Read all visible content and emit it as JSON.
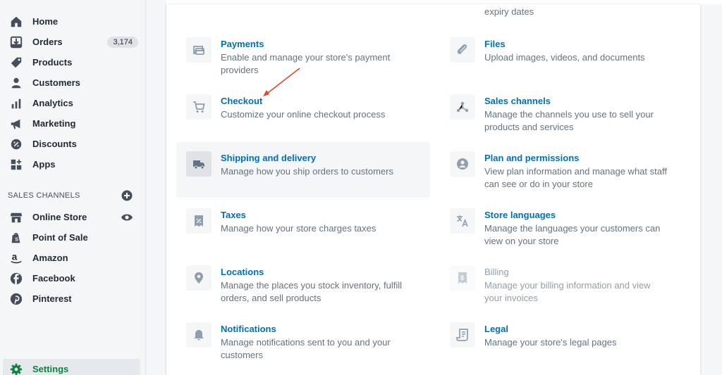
{
  "sidebar": {
    "items": [
      {
        "label": "Home"
      },
      {
        "label": "Orders",
        "badge": "3,174"
      },
      {
        "label": "Products"
      },
      {
        "label": "Customers"
      },
      {
        "label": "Analytics"
      },
      {
        "label": "Marketing"
      },
      {
        "label": "Discounts"
      },
      {
        "label": "Apps"
      }
    ],
    "sales_channels_heading": "SALES CHANNELS",
    "channels": [
      {
        "label": "Online Store"
      },
      {
        "label": "Point of Sale"
      },
      {
        "label": "Amazon"
      },
      {
        "label": "Facebook"
      },
      {
        "label": "Pinterest"
      }
    ],
    "settings_label": "Settings"
  },
  "settings": {
    "top_right_desc": "expiry dates",
    "left": [
      {
        "title": "Payments",
        "desc": "Enable and manage your store's payment providers",
        "icon": "payments-icon"
      },
      {
        "title": "Checkout",
        "desc": "Customize your online checkout process",
        "icon": "cart-icon"
      },
      {
        "title": "Shipping and delivery",
        "desc": "Manage how you ship orders to customers",
        "icon": "truck-icon"
      },
      {
        "title": "Taxes",
        "desc": "Manage how your store charges taxes",
        "icon": "taxes-icon"
      },
      {
        "title": "Locations",
        "desc": "Manage the places you stock inventory, fulfill orders, and sell products",
        "icon": "location-icon"
      },
      {
        "title": "Notifications",
        "desc": "Manage notifications sent to you and your customers",
        "icon": "bell-icon"
      }
    ],
    "right": [
      {
        "title": "Files",
        "desc": "Upload images, videos, and documents",
        "icon": "paperclip-icon"
      },
      {
        "title": "Sales channels",
        "desc": "Manage the channels you use to sell your products and services",
        "icon": "channels-icon"
      },
      {
        "title": "Plan and permissions",
        "desc": "View plan information and manage what staff can see or do in your store",
        "icon": "user-circle-icon"
      },
      {
        "title": "Store languages",
        "desc": "Manage the languages your customers can view on your store",
        "icon": "translate-icon"
      },
      {
        "title": "Billing",
        "desc": "Manage your billing information and view your invoices",
        "icon": "billing-icon"
      },
      {
        "title": "Legal",
        "desc": "Manage your store's legal pages",
        "icon": "legal-icon"
      }
    ]
  },
  "colors": {
    "accent_link": "#006fbb",
    "settings_active": "#108043",
    "annotation_arrow": "#e0452b"
  }
}
